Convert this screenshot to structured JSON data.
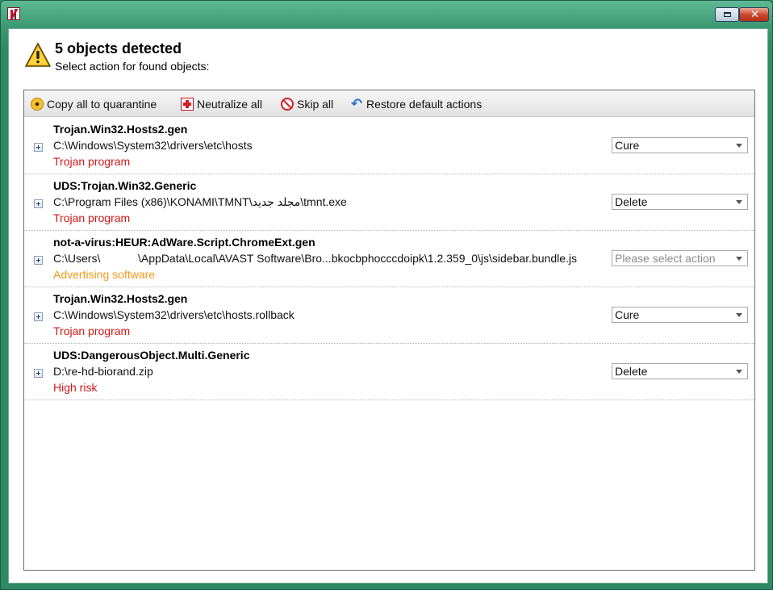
{
  "titlebar": {
    "logo_icon": "kaspersky-k-icon",
    "restore_icon": "restore-window-icon",
    "close_icon": "close-icon",
    "close_glyph": "✕"
  },
  "header": {
    "icon": "warning-triangle-icon",
    "title": "5 objects detected",
    "subtitle": "Select action for found objects:"
  },
  "toolbar": {
    "items": [
      {
        "label": "Copy all to quarantine",
        "icon": "radiation-icon"
      },
      {
        "label": "Neutralize all",
        "icon": "red-cross-icon"
      },
      {
        "label": "Skip all",
        "icon": "stop-icon"
      },
      {
        "label": "Restore default actions",
        "icon": "undo-arrow-icon"
      }
    ]
  },
  "objects": [
    {
      "threat": "Trojan.Win32.Hosts2.gen",
      "path": "C:\\Windows\\System32\\drivers\\etc\\hosts",
      "type": "Trojan program",
      "type_color": "#d01818",
      "action": "Cure"
    },
    {
      "threat": "UDS:Trojan.Win32.Generic",
      "path": "C:\\Program Files (x86)\\KONAMI\\TMNT\\مجلد جديد\\tmnt.exe",
      "type": "Trojan program",
      "type_color": "#d01818",
      "action": "Delete"
    },
    {
      "threat": "not-a-virus:HEUR:AdWare.Script.ChromeExt.gen",
      "path": "C:\\Users\\            \\AppData\\Local\\AVAST Software\\Bro...bkocbphocccdoipk\\1.2.359_0\\js\\sidebar.bundle.js",
      "type": "Advertising software",
      "type_color": "#f09a1a",
      "action": "Please select action"
    },
    {
      "threat": "Trojan.Win32.Hosts2.gen",
      "path": "C:\\Windows\\System32\\drivers\\etc\\hosts.rollback",
      "type": "Trojan program",
      "type_color": "#d01818",
      "action": "Cure"
    },
    {
      "threat": "UDS:DangerousObject.Multi.Generic",
      "path": "D:\\re-hd-biorand.zip",
      "type": "High risk",
      "type_color": "#d01818",
      "action": "Delete"
    }
  ]
}
